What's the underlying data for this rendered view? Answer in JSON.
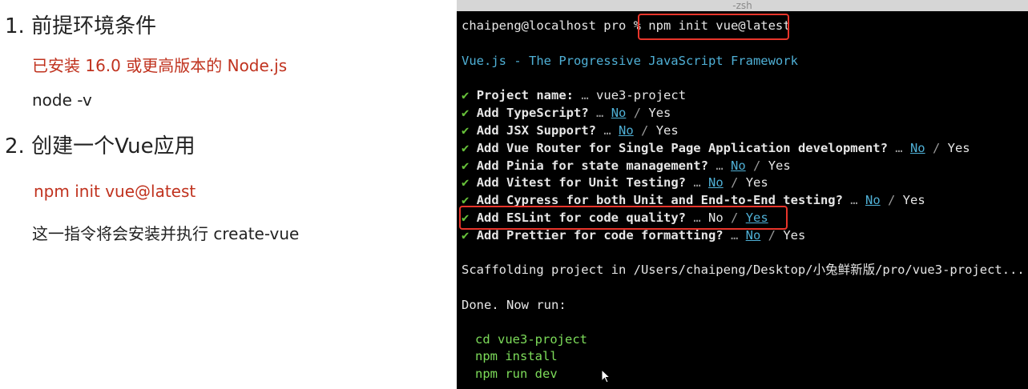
{
  "slide": {
    "step1_title": "1. 前提环境条件",
    "step1_req": "已安装 16.0 或更高版本的 Node.js",
    "step1_cmd": "node  -v",
    "step2_title": "2. 创建一个Vue应用",
    "step2_cmd": "npm init vue@latest",
    "step2_desc": "这一指令将会安装并执行 create-vue"
  },
  "terminal": {
    "window_title": "-zsh",
    "prompt": "chaipeng@localhost pro % ",
    "command": "npm init vue@latest",
    "banner": "Vue.js - The Progressive JavaScript Framework",
    "check_mark": "✔",
    "ellipsis": "…",
    "separator": " / ",
    "questions": [
      {
        "label": "Project name:",
        "answer": "vue3-project"
      },
      {
        "label": "Add TypeScript?",
        "selected": "No",
        "other": "Yes"
      },
      {
        "label": "Add JSX Support?",
        "selected": "No",
        "other": "Yes"
      },
      {
        "label": "Add Vue Router for Single Page Application development?",
        "selected": "No",
        "other": "Yes"
      },
      {
        "label": "Add Pinia for state management?",
        "selected": "No",
        "other": "Yes"
      },
      {
        "label": "Add Vitest for Unit Testing?",
        "selected": "No",
        "other": "Yes"
      },
      {
        "label": "Add Cypress for both Unit and End-to-End testing?",
        "selected": "No",
        "other": "Yes"
      },
      {
        "label": "Add ESLint for code quality?",
        "unselected": "No",
        "selected": "Yes"
      },
      {
        "label": "Add Prettier for code formatting?",
        "selected": "No",
        "other": "Yes"
      }
    ],
    "scaffolding": "Scaffolding project in /Users/chaipeng/Desktop/小兔鲜新版/pro/vue3-project...",
    "done": "Done. Now run:",
    "next_steps": [
      "cd vue3-project",
      "npm install",
      "npm run dev"
    ]
  },
  "colors": {
    "highlight_border": "#e8352b",
    "slide_red_text": "#c0321e",
    "check_green": "#67c23a",
    "banner_cyan": "#4fb0d6"
  }
}
